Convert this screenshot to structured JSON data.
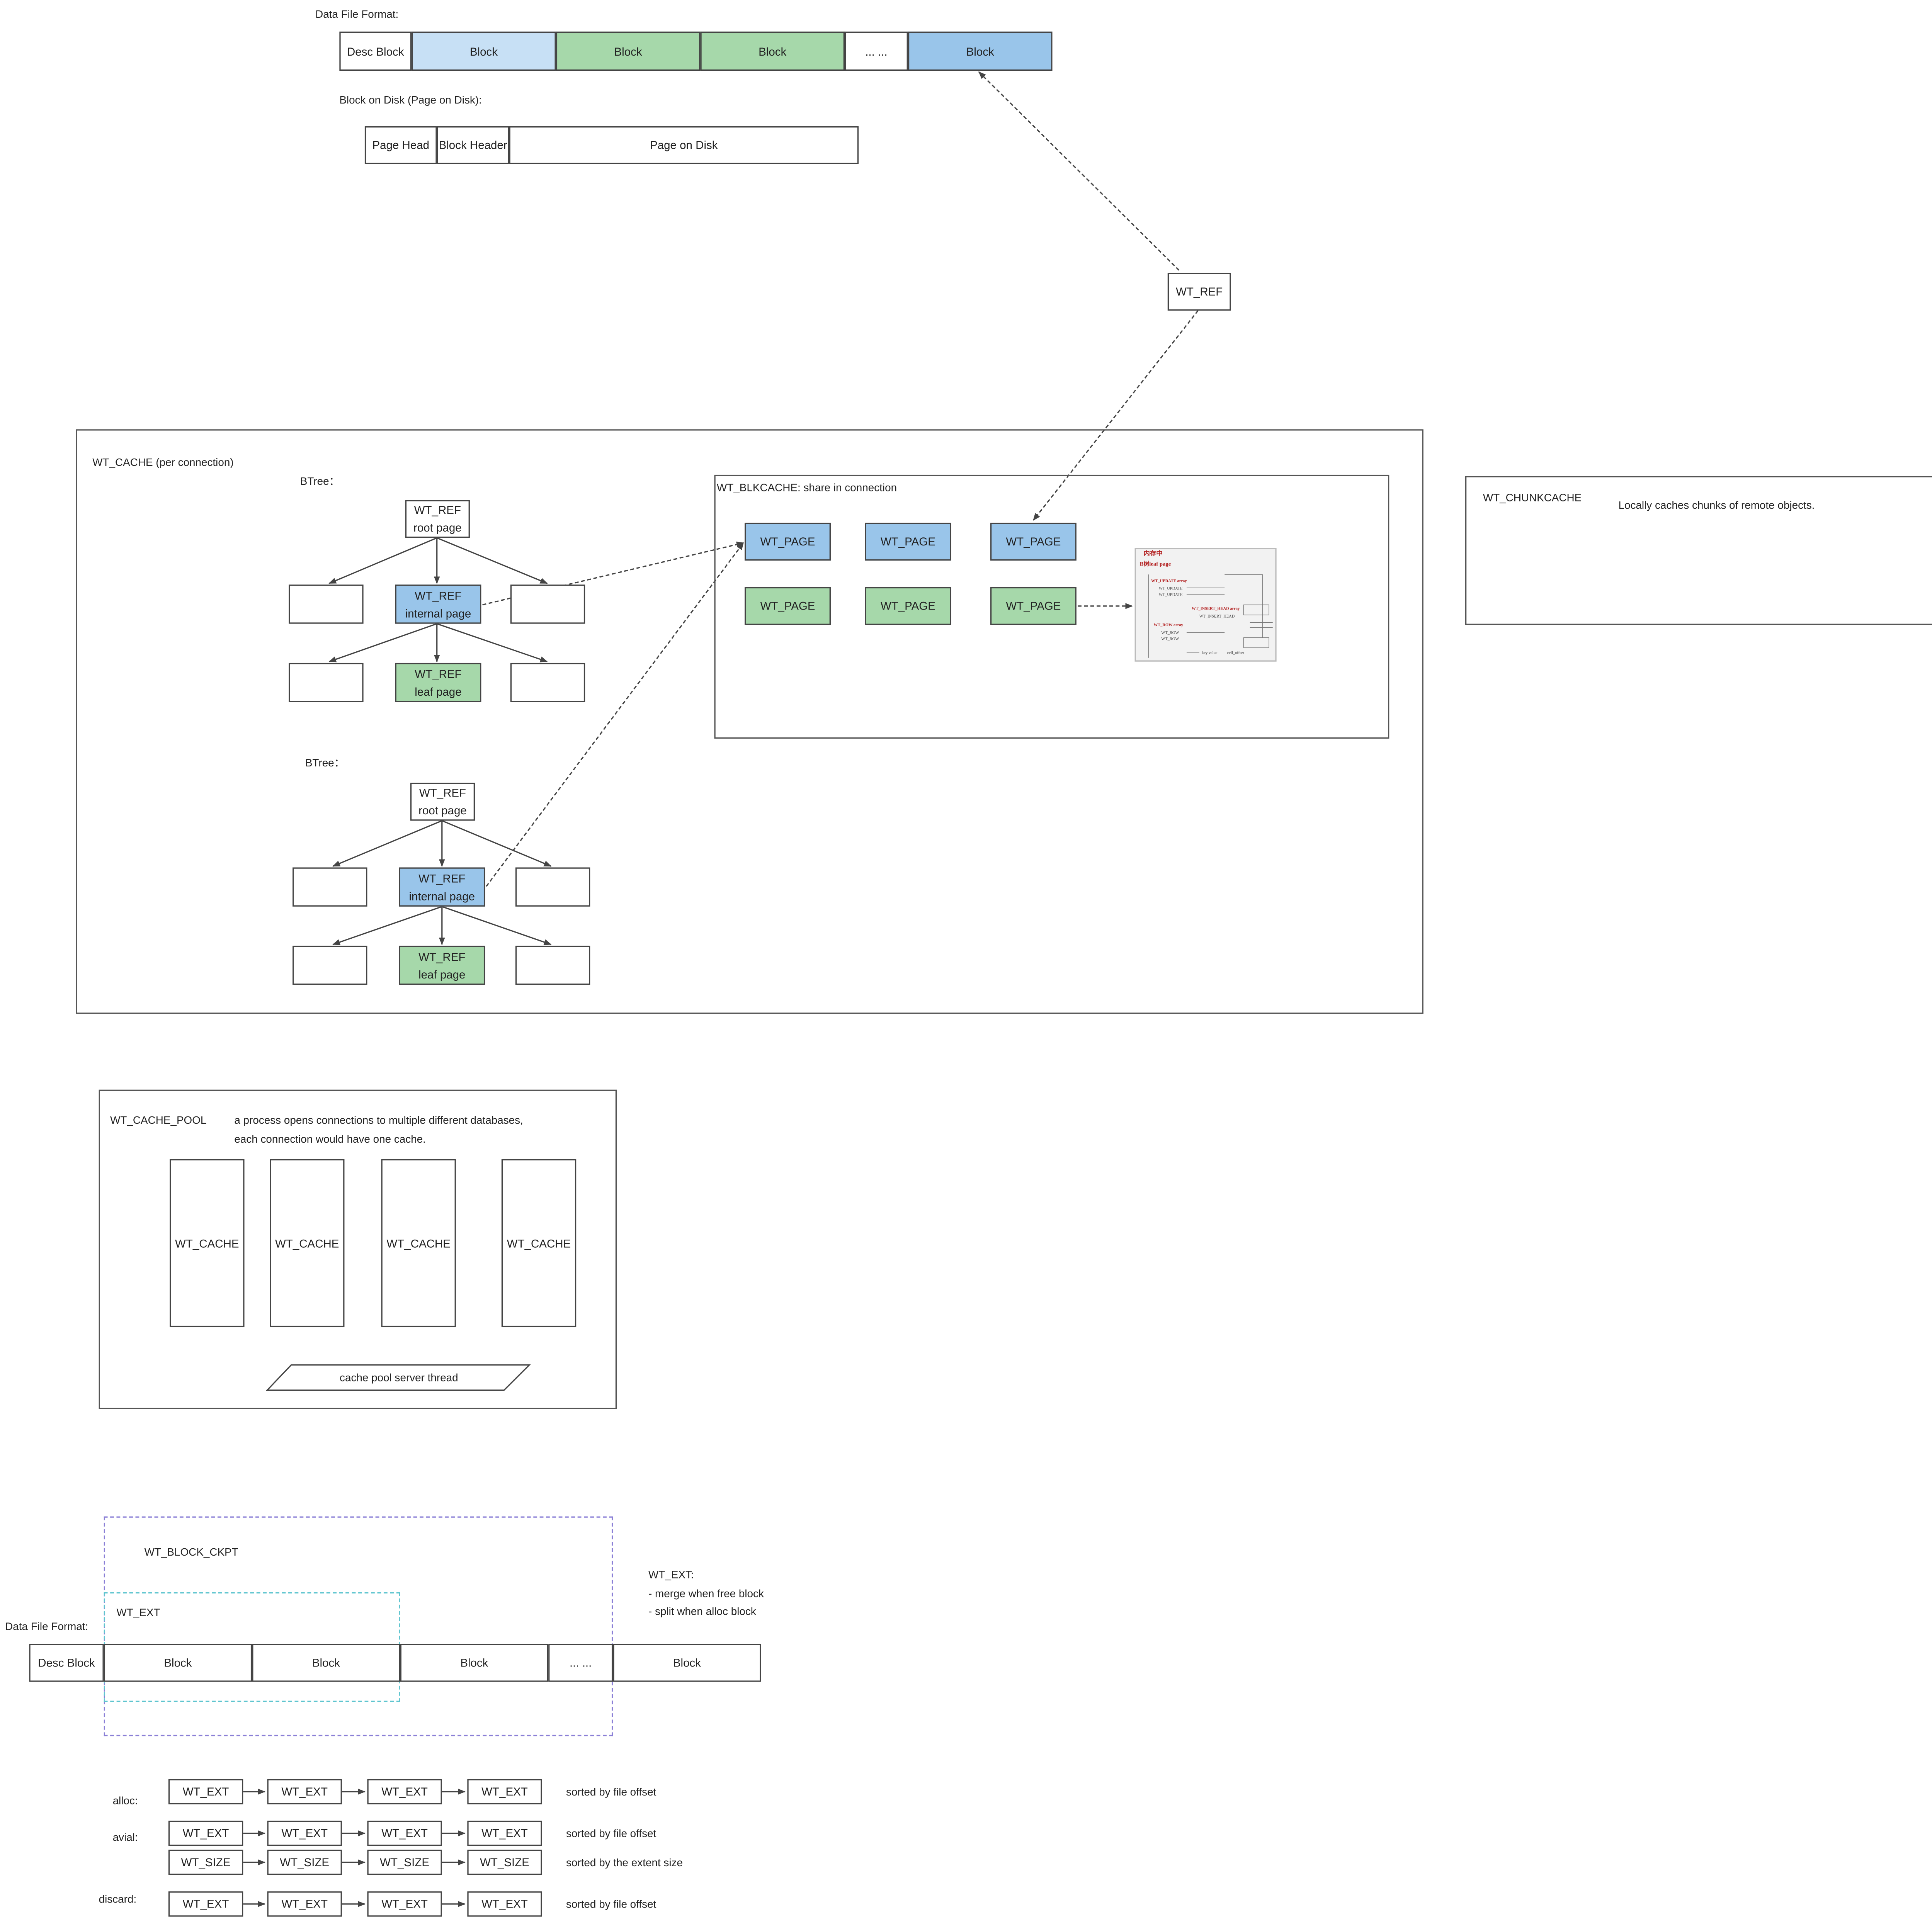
{
  "top_format": {
    "title": "Data File Format:",
    "blocks": [
      "Desc Block",
      "Block",
      "Block",
      "Block",
      "... ...",
      "Block"
    ]
  },
  "disk": {
    "title": "Block on Disk (Page on Disk):",
    "parts": [
      "Page Head",
      "Block Header",
      "Page on Disk"
    ]
  },
  "ref_box": "WT_REF",
  "cache": {
    "title": "WT_CACHE (per connection)",
    "btree_label": "BTree：",
    "root_line1": "WT_REF",
    "root_line2": "root page",
    "internal_line1": "WT_REF",
    "internal_line2": "internal page",
    "leaf_line1": "WT_REF",
    "leaf_line2": "leaf page"
  },
  "blkcache": {
    "title": "WT_BLKCACHE: share in connection",
    "page_label": "WT_PAGE",
    "thumbnail": {
      "title": "内存中",
      "subtitle": "B树leaf page",
      "lines": [
        "WT_UPDATE array",
        "WT_UPDATE",
        "WT_UPDATE",
        "WT_INSERT_HEAD array",
        "WT_INSERT_HEAD",
        "WT_ROW array",
        "WT_ROW",
        "WT_ROW",
        "key value",
        "cell_offset"
      ]
    }
  },
  "chunkcache": {
    "title": "WT_CHUNKCACHE",
    "desc": "Locally caches chunks of remote objects."
  },
  "pool": {
    "title": "WT_CACHE_POOL",
    "desc_line1": "a process opens connections to multiple different databases,",
    "desc_line2": "each connection would have one cache.",
    "cache_label": "WT_CACHE",
    "thread_label": "cache pool server thread"
  },
  "ckpt": {
    "title": "WT_BLOCK_CKPT",
    "ext_label": "WT_EXT",
    "note_title": "WT_EXT:",
    "note_line1": "- merge when free block",
    "note_line2": "- split when alloc block",
    "format_title": "Data File Format:",
    "blocks": [
      "Desc Block",
      "Block",
      "Block",
      "Block",
      "... ...",
      "Block"
    ]
  },
  "lists": {
    "alloc_label": "alloc:",
    "avail_label": "avial:",
    "discard_label": "discard:",
    "ext_label": "WT_EXT",
    "size_label": "WT_SIZE",
    "sorted_offset": "sorted by file offset",
    "sorted_size": "sorted by the extent size"
  },
  "colors": {
    "light_blue": "#c7e0f5",
    "mid_blue": "#99c5ea",
    "green": "#a6d8aa",
    "purple_dash": "#8a7fd6",
    "teal_dash": "#5fc5cf"
  }
}
